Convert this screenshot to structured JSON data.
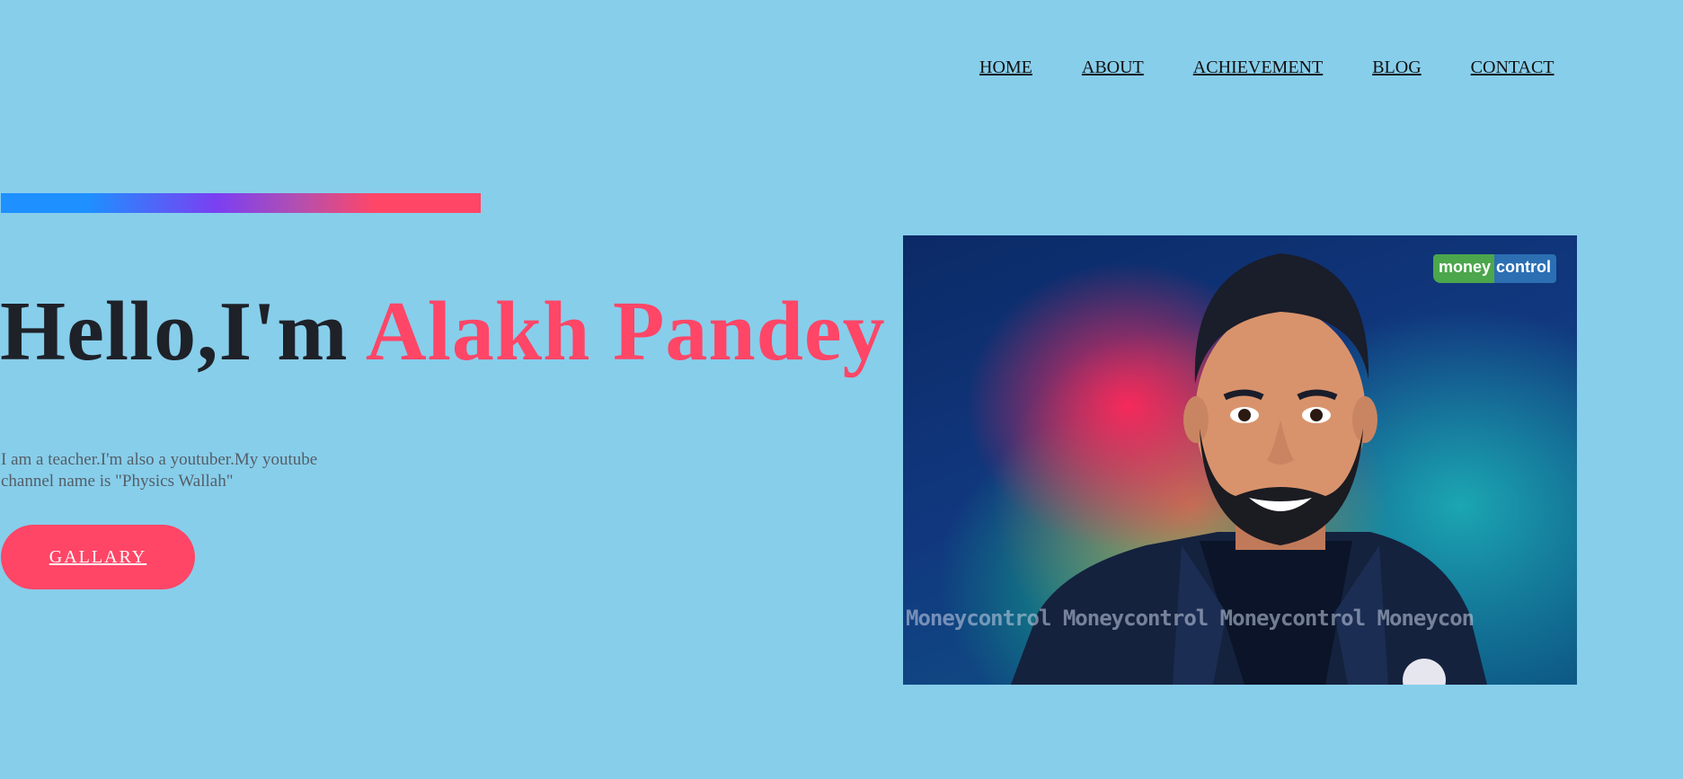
{
  "nav": {
    "items": [
      {
        "label": "HOME"
      },
      {
        "label": "ABOUT"
      },
      {
        "label": "ACHIEVEMENT"
      },
      {
        "label": "BLOG"
      },
      {
        "label": "CONTACT"
      }
    ]
  },
  "hero": {
    "greeting": "Hello,I'm ",
    "name": "Alakh Pandey",
    "intro": "I am a teacher.I'm also a youtuber.My youtube channel name is \"Physics Wallah\"",
    "button_label": "GALLARY"
  },
  "photo": {
    "logo_green": "money",
    "logo_blue": "control",
    "watermark": "Moneycontrol  Moneycontrol  Moneycontrol  Moneycon"
  },
  "colors": {
    "background": "#87CEEB",
    "accent": "#FF4667",
    "heading": "#1e2128",
    "bar_gradient": [
      "#1E90FF",
      "#7B3FF2",
      "#FF4667"
    ]
  }
}
